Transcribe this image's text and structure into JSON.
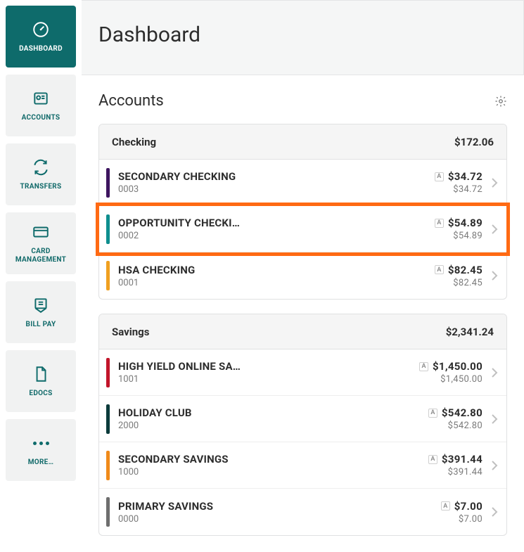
{
  "header": {
    "title": "Dashboard"
  },
  "sidebar": {
    "items": [
      {
        "label": "DASHBOARD"
      },
      {
        "label": "ACCOUNTS"
      },
      {
        "label": "TRANSFERS"
      },
      {
        "label": "CARD MANAGEMENT"
      },
      {
        "label": "BILL PAY"
      },
      {
        "label": "EDOCS"
      },
      {
        "label": "MORE…"
      }
    ]
  },
  "accounts_section": {
    "title": "Accounts"
  },
  "groups": [
    {
      "name": "Checking",
      "total": "$172.06",
      "accounts": [
        {
          "name": "SECONDARY CHECKING",
          "number": "0003",
          "balance": "$34.72",
          "available": "$34.72",
          "color": "#3d155f",
          "badge": "A"
        },
        {
          "name": "OPPORTUNITY CHECKI…",
          "number": "0002",
          "balance": "$54.89",
          "available": "$54.89",
          "color": "#0e8e8e",
          "badge": "A"
        },
        {
          "name": "HSA CHECKING",
          "number": "0001",
          "balance": "$82.45",
          "available": "$82.45",
          "color": "#f0a020",
          "badge": "A"
        }
      ]
    },
    {
      "name": "Savings",
      "total": "$2,341.24",
      "accounts": [
        {
          "name": "HIGH YIELD ONLINE SA…",
          "number": "1001",
          "balance": "$1,450.00",
          "available": "$1,450.00",
          "color": "#c2152a",
          "badge": "A"
        },
        {
          "name": "HOLIDAY CLUB",
          "number": "2000",
          "balance": "$542.80",
          "available": "$542.80",
          "color": "#0b3b3b",
          "badge": "A"
        },
        {
          "name": "SECONDARY SAVINGS",
          "number": "1000",
          "balance": "$391.44",
          "available": "$391.44",
          "color": "#f08a1a",
          "badge": "A"
        },
        {
          "name": "PRIMARY SAVINGS",
          "number": "0000",
          "balance": "$7.00",
          "available": "$7.00",
          "color": "#6e6e6e",
          "badge": "A"
        }
      ]
    }
  ],
  "highlight": {
    "group": 0,
    "account": 1
  }
}
